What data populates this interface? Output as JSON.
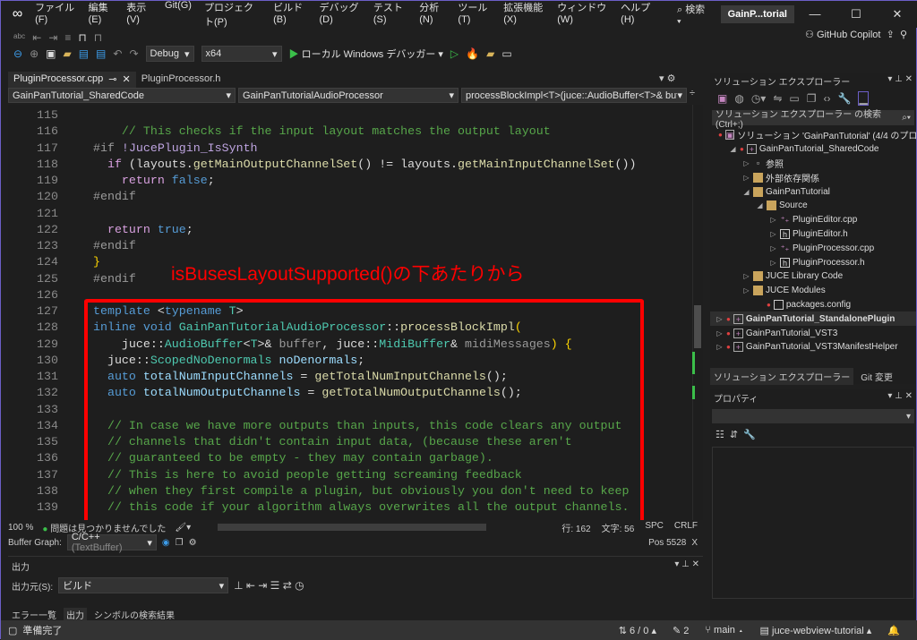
{
  "menubar": {
    "items": [
      "ファイル(F)",
      "編集(E)",
      "表示(V)",
      "Git(G)",
      "プロジェクト(P)",
      "ビルド(B)",
      "デバッグ(D)",
      "テスト(S)",
      "分析(N)",
      "ツール(T)",
      "拡張機能(X)",
      "ウィンドウ(W)",
      "ヘルプ(H)"
    ],
    "search": "検索",
    "solution_title": "GainP...torial"
  },
  "toolbar": {
    "config": "Debug",
    "platform": "x64",
    "run": "ローカル Windows デバッガー",
    "copilot": "GitHub Copilot"
  },
  "tabs": [
    {
      "label": "PluginProcessor.cpp",
      "active": true
    },
    {
      "label": "PluginProcessor.h",
      "active": false
    }
  ],
  "navbar": {
    "project": "GainPanTutorial_SharedCode",
    "class": "GainPanTutorialAudioProcessor",
    "member": "processBlockImpl<T>(juce::AudioBuffer<T>& buffe"
  },
  "code": [
    {
      "n": "115",
      "t": []
    },
    {
      "n": "116",
      "t": [
        [
          "pl",
          "    "
        ],
        [
          "cm",
          "// This checks if the input layout matches the output layout"
        ]
      ]
    },
    {
      "n": "117",
      "t": [
        [
          "pp",
          "#if "
        ],
        [
          "mac",
          "!JucePlugin_IsSynth"
        ]
      ]
    },
    {
      "n": "118",
      "t": [
        [
          "pl",
          "  "
        ],
        [
          "ctl",
          "if"
        ],
        [
          "pl",
          " (layouts."
        ],
        [
          "fn",
          "getMainOutputChannelSet"
        ],
        [
          "pl",
          "() != layouts."
        ],
        [
          "fn",
          "getMainInputChannelSet"
        ],
        [
          "pl",
          "())"
        ]
      ]
    },
    {
      "n": "119",
      "t": [
        [
          "pl",
          "    "
        ],
        [
          "ctl",
          "return"
        ],
        [
          "pl",
          " "
        ],
        [
          "kw",
          "false"
        ],
        [
          "pl",
          ";"
        ]
      ]
    },
    {
      "n": "120",
      "t": [
        [
          "pp",
          "#endif"
        ]
      ]
    },
    {
      "n": "121",
      "t": []
    },
    {
      "n": "122",
      "t": [
        [
          "pl",
          "  "
        ],
        [
          "ctl",
          "return"
        ],
        [
          "pl",
          " "
        ],
        [
          "kw",
          "true"
        ],
        [
          "pl",
          ";"
        ]
      ]
    },
    {
      "n": "123",
      "t": [
        [
          "pp",
          "#endif"
        ]
      ]
    },
    {
      "n": "124",
      "t": [
        [
          "br",
          "}"
        ]
      ]
    },
    {
      "n": "125",
      "t": [
        [
          "pp",
          "#endif"
        ]
      ]
    },
    {
      "n": "126",
      "t": []
    },
    {
      "n": "127",
      "t": [
        [
          "kw",
          "template"
        ],
        [
          "pl",
          " <"
        ],
        [
          "kw",
          "typename"
        ],
        [
          "pl",
          " "
        ],
        [
          "ty",
          "T"
        ],
        [
          "pl",
          ">"
        ]
      ]
    },
    {
      "n": "128",
      "t": [
        [
          "kw",
          "inline void"
        ],
        [
          "pl",
          " "
        ],
        [
          "ty",
          "GainPanTutorialAudioProcessor"
        ],
        [
          "pl",
          "::"
        ],
        [
          "fn",
          "processBlockImpl"
        ],
        [
          "br",
          "("
        ]
      ]
    },
    {
      "n": "129",
      "t": [
        [
          "pl",
          "    juce::"
        ],
        [
          "ty",
          "AudioBuffer"
        ],
        [
          "pl",
          "<"
        ],
        [
          "ty",
          "T"
        ],
        [
          "pl",
          ">& "
        ],
        [
          "par",
          "buffer"
        ],
        [
          "pl",
          ", juce::"
        ],
        [
          "ty",
          "MidiBuffer"
        ],
        [
          "pl",
          "& "
        ],
        [
          "par",
          "midiMessages"
        ],
        [
          "br",
          ")"
        ],
        [
          "pl",
          " "
        ],
        [
          "br",
          "{"
        ]
      ]
    },
    {
      "n": "130",
      "t": [
        [
          "pl",
          "  juce::"
        ],
        [
          "ty",
          "ScopedNoDenormals"
        ],
        [
          "pl",
          " "
        ],
        [
          "var",
          "noDenormals"
        ],
        [
          "pl",
          ";"
        ]
      ]
    },
    {
      "n": "131",
      "t": [
        [
          "pl",
          "  "
        ],
        [
          "kw",
          "auto"
        ],
        [
          "pl",
          " "
        ],
        [
          "var",
          "totalNumInputChannels"
        ],
        [
          "pl",
          " = "
        ],
        [
          "fn",
          "getTotalNumInputChannels"
        ],
        [
          "pl",
          "();"
        ]
      ]
    },
    {
      "n": "132",
      "t": [
        [
          "pl",
          "  "
        ],
        [
          "kw",
          "auto"
        ],
        [
          "pl",
          " "
        ],
        [
          "var",
          "totalNumOutputChannels"
        ],
        [
          "pl",
          " = "
        ],
        [
          "fn",
          "getTotalNumOutputChannels"
        ],
        [
          "pl",
          "();"
        ]
      ]
    },
    {
      "n": "133",
      "t": []
    },
    {
      "n": "134",
      "t": [
        [
          "pl",
          "  "
        ],
        [
          "cm",
          "// In case we have more outputs than inputs, this code clears any output"
        ]
      ]
    },
    {
      "n": "135",
      "t": [
        [
          "pl",
          "  "
        ],
        [
          "cm",
          "// channels that didn't contain input data, (because these aren't"
        ]
      ]
    },
    {
      "n": "136",
      "t": [
        [
          "pl",
          "  "
        ],
        [
          "cm",
          "// guaranteed to be empty - they may contain garbage)."
        ]
      ]
    },
    {
      "n": "137",
      "t": [
        [
          "pl",
          "  "
        ],
        [
          "cm",
          "// This is here to avoid people getting screaming feedback"
        ]
      ]
    },
    {
      "n": "138",
      "t": [
        [
          "pl",
          "  "
        ],
        [
          "cm",
          "// when they first compile a plugin, but obviously you don't need to keep"
        ]
      ]
    },
    {
      "n": "139",
      "t": [
        [
          "pl",
          "  "
        ],
        [
          "cm",
          "// this code if your algorithm always overwrites all the output channels."
        ]
      ]
    }
  ],
  "annotation": "isBusesLayoutSupported()の下あたりから",
  "editor_status": {
    "zoom": "100 %",
    "issues": "問題は見つかりませんでした",
    "line": "行: 162",
    "col": "文字: 56",
    "spc": "SPC",
    "crlf": "CRLF"
  },
  "buffer_graph": {
    "label": "Buffer Graph:",
    "value": "C/C++",
    "sub": "(TextBuffer)",
    "pos": "Pos 5528",
    "close": "X"
  },
  "output": {
    "title": "出力",
    "source_label": "出力元(S):",
    "source": "ビルド",
    "tabs": [
      "エラー一覧",
      "出力",
      "シンボルの検索結果"
    ]
  },
  "statusbar": {
    "ready": "準備完了",
    "changes": "6 / 0",
    "edits": "2",
    "branch": "main",
    "repo": "juce-webview-tutorial"
  },
  "solution_explorer": {
    "title": "ソリューション エクスプローラー",
    "search": "ソリューション エクスプローラー の検索 (Ctrl+;)",
    "items": [
      {
        "label": "ソリューション 'GainPanTutorial' (4/4 のプロジェクト",
        "depth": 0,
        "icon": "solution",
        "arrow": ""
      },
      {
        "label": "GainPanTutorial_SharedCode",
        "depth": 1,
        "icon": "proj",
        "arrow": "◢"
      },
      {
        "label": "参照",
        "depth": 2,
        "icon": "ref",
        "arrow": "▷"
      },
      {
        "label": "外部依存関係",
        "depth": 2,
        "icon": "folder",
        "arrow": "▷"
      },
      {
        "label": "GainPanTutorial",
        "depth": 2,
        "icon": "folder",
        "arrow": "◢"
      },
      {
        "label": "Source",
        "depth": 3,
        "icon": "folder",
        "arrow": "◢"
      },
      {
        "label": "PluginEditor.cpp",
        "depth": 4,
        "icon": "cpp",
        "arrow": "▷"
      },
      {
        "label": "PluginEditor.h",
        "depth": 4,
        "icon": "h",
        "arrow": "▷"
      },
      {
        "label": "PluginProcessor.cpp",
        "depth": 4,
        "icon": "cpp",
        "arrow": "▷"
      },
      {
        "label": "PluginProcessor.h",
        "depth": 4,
        "icon": "h",
        "arrow": "▷"
      },
      {
        "label": "JUCE Library Code",
        "depth": 2,
        "icon": "folder",
        "arrow": "▷"
      },
      {
        "label": "JUCE Modules",
        "depth": 2,
        "icon": "folder",
        "arrow": "▷"
      },
      {
        "label": "packages.config",
        "depth": 3,
        "icon": "file",
        "arrow": ""
      },
      {
        "label": "GainPanTutorial_StandalonePlugin",
        "depth": 0,
        "icon": "proj",
        "arrow": "▷",
        "bold": true
      },
      {
        "label": "GainPanTutorial_VST3",
        "depth": 0,
        "icon": "proj",
        "arrow": "▷"
      },
      {
        "label": "GainPanTutorial_VST3ManifestHelper",
        "depth": 0,
        "icon": "proj",
        "arrow": "▷"
      }
    ],
    "tabs": [
      "ソリューション エクスプローラー",
      "Git 変更"
    ]
  },
  "properties": {
    "title": "プロパティ"
  },
  "colors": {
    "annotation": "#ff0000",
    "accent": "#6c5fc7",
    "comment": "#57a64a",
    "keyword": "#569cd6"
  }
}
